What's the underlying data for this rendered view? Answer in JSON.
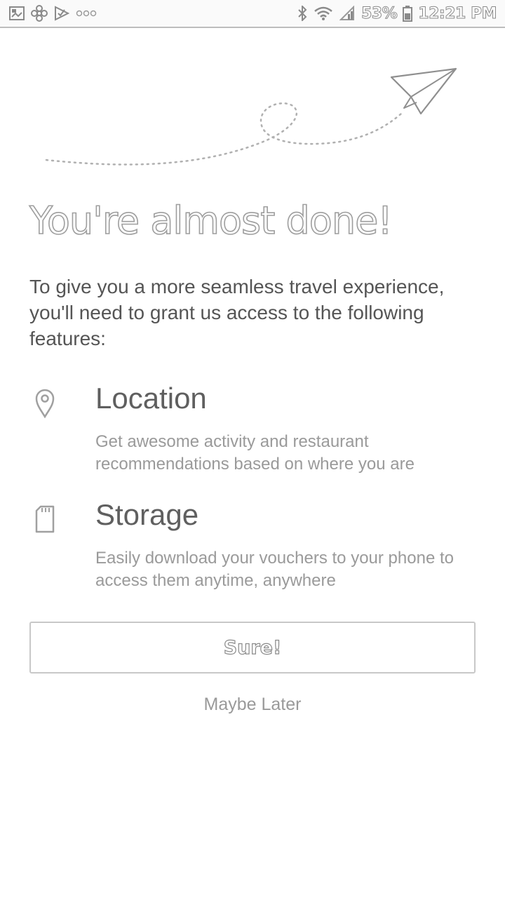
{
  "status_bar": {
    "left_icons": [
      "gallery-icon",
      "pinwheel-icon",
      "checkmark-icon",
      "more-dots-icon"
    ],
    "right_icons": [
      "bluetooth-icon",
      "wifi-icon",
      "signal-icon",
      "battery-icon"
    ],
    "battery_text": "53%",
    "time": "12:21 PM"
  },
  "illustration": {
    "icon": "paper-plane-icon"
  },
  "headline": "You're almost done!",
  "intro_text": "To give you a more seamless travel experience, you'll need to grant us access to the following features:",
  "features": [
    {
      "icon": "location-pin-icon",
      "title": "Location",
      "description": "Get awesome activity and restaurant recommendations based on where you are"
    },
    {
      "icon": "sd-card-icon",
      "title": "Storage",
      "description": "Easily download your vouchers to your phone to access them anytime, anywhere"
    }
  ],
  "actions": {
    "primary_label": "Sure!",
    "secondary_label": "Maybe Later"
  },
  "colors": {
    "background": "#ffffff",
    "text_primary": "#555555",
    "text_secondary": "#9a9a9a",
    "button_border": "#c8c8c8"
  }
}
